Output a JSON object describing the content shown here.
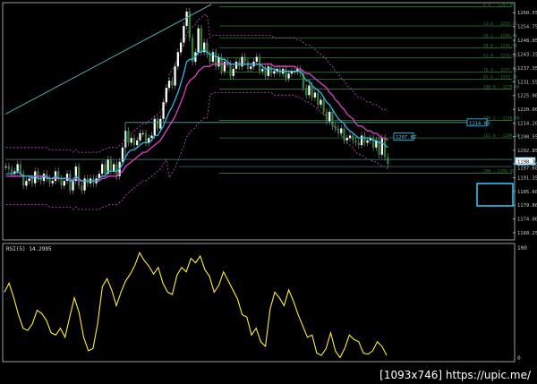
{
  "colors": {
    "bg": "#000000",
    "frame": "#9aa0a6",
    "grid": "#3a3a3a",
    "up_candle": "#ffffff",
    "down_candle": "#2e7d32",
    "wick": "#9e9e9e",
    "ema_fast": "#2fb7e6",
    "ema_slow": "#e040c8",
    "bands": "#c24fd0",
    "fib": "#2e7d32",
    "trend": "#4fa9a9",
    "rsi": "#ffee33",
    "box": "#33ccff"
  },
  "price_panel": {
    "y_ticks": [
      "1260.55",
      "1254.75",
      "1248.95",
      "1243.15",
      "1237.35",
      "1231.55",
      "1225.80",
      "1220.00",
      "1214.20",
      "1208.55",
      "1202.85",
      "1197.20",
      "1191.35",
      "1185.60",
      "1179.80",
      "1174.00",
      "1168.25"
    ],
    "labels": {
      "level_1214": "1214.03",
      "level_1207": "1207.87",
      "last_price": "1198.30",
      "below_last": "1197.60"
    },
    "fib_levels": [
      {
        "price": 1263.0,
        "label": "0.0 - 1263.00"
      },
      {
        "price": 1255.0,
        "label": "23.6 - 1255.25"
      },
      {
        "price": 1250.0,
        "label": "38.2 - 1250.40"
      },
      {
        "price": 1245.8,
        "label": "50.0 - 1246.50"
      },
      {
        "price": 1241.6,
        "label": "61.8 - 1242.60"
      },
      {
        "price": 1235.6,
        "label": "76.4 - 1237.80"
      },
      {
        "price": 1232.6,
        "label": "85.4 - 1233.20"
      },
      {
        "price": 1228.5,
        "label": "100.0 - 1229.60"
      },
      {
        "price": 1215.4,
        "label": "138.2 - 1216.90"
      },
      {
        "price": 1208.0,
        "label": "161.8 - 1209.20"
      },
      {
        "price": 1193.2,
        "label": "200 - 1196.00"
      }
    ]
  },
  "rsi_panel": {
    "title": "RSI(5) 14.2995",
    "ticks": [
      "100",
      "0"
    ]
  },
  "watermark": "[1093x746] https://upic.me/",
  "chart_data": [
    {
      "type": "candlestick",
      "title": "",
      "ylim": [
        1166,
        1264
      ],
      "y_ticks": [
        1260.55,
        1254.75,
        1248.95,
        1243.15,
        1237.35,
        1231.55,
        1225.8,
        1220.0,
        1214.2,
        1208.55,
        1202.85,
        1197.2,
        1191.35,
        1185.6,
        1179.8,
        1174.0,
        1168.25
      ],
      "close": [
        1196,
        1195,
        1193,
        1194,
        1197,
        1193,
        1188,
        1190,
        1191,
        1189,
        1194,
        1191,
        1190,
        1193,
        1191,
        1189,
        1190,
        1194,
        1191,
        1188,
        1190,
        1193,
        1186,
        1190,
        1196,
        1188,
        1186,
        1191,
        1189,
        1191,
        1189,
        1191,
        1193,
        1197,
        1193,
        1199,
        1194,
        1197,
        1192,
        1198,
        1204,
        1211,
        1206,
        1208,
        1205,
        1207,
        1210,
        1210,
        1206,
        1208,
        1209,
        1216,
        1212,
        1216,
        1223,
        1229,
        1232,
        1230,
        1238,
        1244,
        1248,
        1255,
        1261,
        1250,
        1240,
        1244,
        1254,
        1244,
        1248,
        1243,
        1240,
        1244,
        1238,
        1242,
        1236,
        1240,
        1239,
        1234,
        1237,
        1240,
        1238,
        1242,
        1240,
        1237,
        1238,
        1240,
        1242,
        1236,
        1237,
        1234,
        1238,
        1235,
        1236,
        1237,
        1235,
        1237,
        1233,
        1235,
        1236,
        1236,
        1237,
        1235,
        1229,
        1226,
        1230,
        1225,
        1227,
        1222,
        1224,
        1219,
        1215,
        1219,
        1213,
        1212,
        1210,
        1212,
        1207,
        1208,
        1209,
        1207,
        1206,
        1205,
        1209,
        1206,
        1207,
        1208,
        1204,
        1207,
        1201,
        1208,
        1200,
        1197
      ],
      "series": [
        {
          "name": "EMA fast",
          "values": [
            1193,
            1193,
            1193,
            1193,
            1194,
            1193,
            1192,
            1192,
            1192,
            1191,
            1192,
            1191,
            1191,
            1192,
            1191,
            1191,
            1191,
            1192,
            1191,
            1191,
            1191,
            1191,
            1190,
            1190,
            1192,
            1191,
            1190,
            1190,
            1190,
            1190,
            1190,
            1190,
            1191,
            1192,
            1192,
            1194,
            1194,
            1194,
            1194,
            1195,
            1197,
            1200,
            1202,
            1203,
            1203,
            1204,
            1205,
            1206,
            1206,
            1206,
            1207,
            1209,
            1209,
            1211,
            1213,
            1216,
            1219,
            1221,
            1224,
            1227,
            1231,
            1235,
            1240,
            1241,
            1241,
            1242,
            1244,
            1244,
            1245,
            1244,
            1243,
            1243,
            1242,
            1242,
            1241,
            1241,
            1240,
            1239,
            1239,
            1239,
            1239,
            1239,
            1239,
            1239,
            1239,
            1239,
            1239,
            1239,
            1238,
            1237,
            1237,
            1237,
            1237,
            1236,
            1236,
            1236,
            1236,
            1236,
            1236,
            1236,
            1236,
            1236,
            1234,
            1232,
            1232,
            1230,
            1229,
            1228,
            1227,
            1225,
            1223,
            1222,
            1220,
            1218,
            1216,
            1215,
            1214,
            1212,
            1211,
            1210,
            1209,
            1208,
            1208,
            1208,
            1208,
            1208,
            1207,
            1207,
            1206,
            1206,
            1205,
            1204
          ]
        },
        {
          "name": "EMA slow",
          "values": [
            1192,
            1192,
            1192,
            1192,
            1192,
            1192,
            1192,
            1192,
            1192,
            1192,
            1192,
            1192,
            1192,
            1192,
            1192,
            1191,
            1191,
            1191,
            1191,
            1191,
            1191,
            1191,
            1191,
            1190,
            1191,
            1190,
            1190,
            1190,
            1190,
            1190,
            1190,
            1190,
            1190,
            1191,
            1191,
            1192,
            1192,
            1192,
            1192,
            1193,
            1194,
            1196,
            1197,
            1198,
            1199,
            1200,
            1201,
            1202,
            1202,
            1203,
            1204,
            1205,
            1206,
            1207,
            1209,
            1211,
            1213,
            1215,
            1217,
            1220,
            1223,
            1226,
            1230,
            1232,
            1233,
            1234,
            1236,
            1237,
            1238,
            1238,
            1238,
            1239,
            1239,
            1239,
            1239,
            1239,
            1239,
            1239,
            1239,
            1239,
            1239,
            1239,
            1239,
            1239,
            1239,
            1239,
            1239,
            1239,
            1239,
            1239,
            1239,
            1239,
            1238,
            1238,
            1238,
            1238,
            1238,
            1238,
            1238,
            1238,
            1237,
            1237,
            1236,
            1235,
            1235,
            1234,
            1233,
            1232,
            1231,
            1230,
            1229,
            1227,
            1226,
            1224,
            1223,
            1221,
            1220,
            1218,
            1217,
            1216,
            1214,
            1213,
            1213,
            1212,
            1211,
            1211,
            1210,
            1210,
            1209,
            1208,
            1208,
            1207
          ]
        }
      ]
    },
    {
      "type": "line",
      "title": "RSI(5) 14.2995",
      "ylim": [
        0,
        100
      ],
      "y_ticks": [
        100,
        0
      ],
      "series": [
        {
          "name": "RSI(5)",
          "values": [
            60,
            68,
            55,
            40,
            28,
            26,
            32,
            44,
            41,
            35,
            24,
            22,
            28,
            20,
            38,
            55,
            42,
            20,
            8,
            10,
            32,
            65,
            72,
            62,
            48,
            60,
            70,
            76,
            84,
            95,
            88,
            83,
            76,
            82,
            68,
            60,
            58,
            75,
            82,
            78,
            90,
            86,
            92,
            80,
            74,
            60,
            66,
            78,
            70,
            62,
            54,
            40,
            38,
            22,
            28,
            16,
            12,
            45,
            60,
            55,
            48,
            62,
            52,
            40,
            30,
            20,
            22,
            6,
            4,
            10,
            24,
            8,
            2,
            10,
            22,
            18,
            16,
            6,
            5,
            8,
            16,
            12,
            4
          ]
        }
      ]
    }
  ]
}
